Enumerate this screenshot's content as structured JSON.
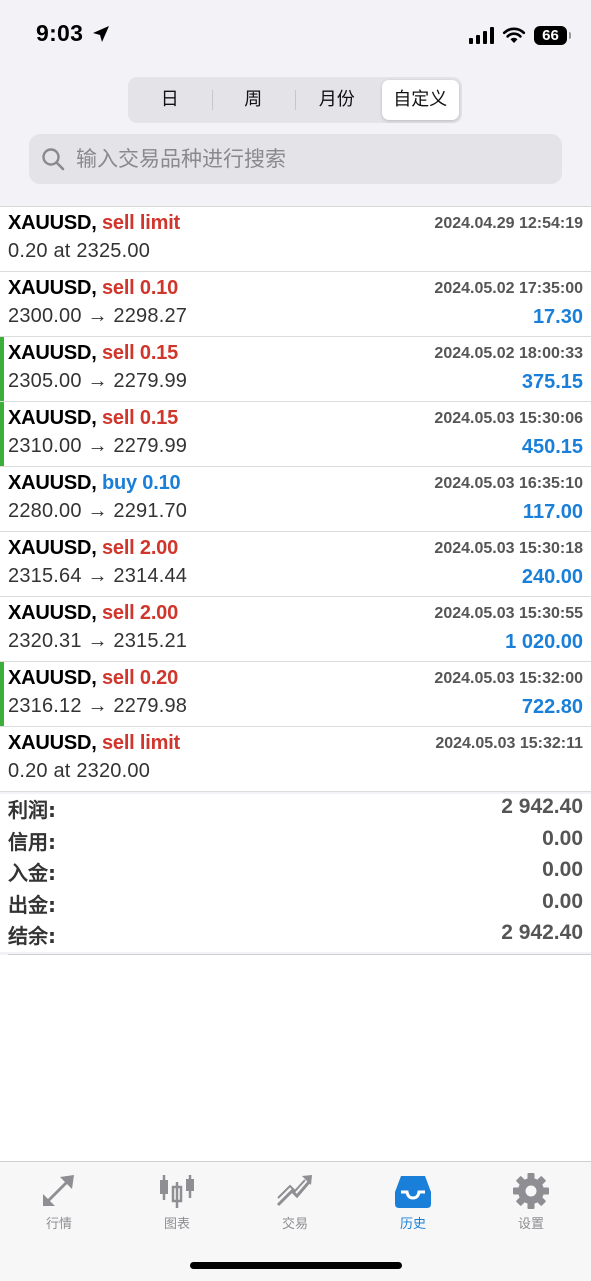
{
  "status_bar": {
    "time": "9:03",
    "battery": "66"
  },
  "period_tabs": [
    {
      "label": "日",
      "active": false
    },
    {
      "label": "周",
      "active": false
    },
    {
      "label": "月份",
      "active": false
    },
    {
      "label": "自定义",
      "active": true
    }
  ],
  "search": {
    "placeholder": "输入交易品种进行搜索"
  },
  "deals": [
    {
      "symbol": "XAUUSD",
      "side": "sell",
      "action": "sell limit",
      "time": "2024.04.29 12:54:19",
      "prices": "0.20 at 2325.00",
      "profit": "",
      "marked": false
    },
    {
      "symbol": "XAUUSD",
      "side": "sell",
      "action": "sell 0.10",
      "time": "2024.05.02 17:35:00",
      "prices": "2300.00 → 2298.27",
      "profit": "17.30",
      "marked": false
    },
    {
      "symbol": "XAUUSD",
      "side": "sell",
      "action": "sell 0.15",
      "time": "2024.05.02 18:00:33",
      "prices": "2305.00 → 2279.99",
      "profit": "375.15",
      "marked": true
    },
    {
      "symbol": "XAUUSD",
      "side": "sell",
      "action": "sell 0.15",
      "time": "2024.05.03 15:30:06",
      "prices": "2310.00 → 2279.99",
      "profit": "450.15",
      "marked": true
    },
    {
      "symbol": "XAUUSD",
      "side": "buy",
      "action": "buy 0.10",
      "time": "2024.05.03 16:35:10",
      "prices": "2280.00 → 2291.70",
      "profit": "117.00",
      "marked": false
    },
    {
      "symbol": "XAUUSD",
      "side": "sell",
      "action": "sell 2.00",
      "time": "2024.05.03 15:30:18",
      "prices": "2315.64 → 2314.44",
      "profit": "240.00",
      "marked": false
    },
    {
      "symbol": "XAUUSD",
      "side": "sell",
      "action": "sell 2.00",
      "time": "2024.05.03 15:30:55",
      "prices": "2320.31 → 2315.21",
      "profit": "1 020.00",
      "marked": false
    },
    {
      "symbol": "XAUUSD",
      "side": "sell",
      "action": "sell 0.20",
      "time": "2024.05.03 15:32:00",
      "prices": "2316.12 → 2279.98",
      "profit": "722.80",
      "marked": true
    },
    {
      "symbol": "XAUUSD",
      "side": "sell",
      "action": "sell limit",
      "time": "2024.05.03 15:32:11",
      "prices": "0.20 at 2320.00",
      "profit": "",
      "marked": false
    }
  ],
  "summary": [
    {
      "label": "利润:",
      "value": "2 942.40"
    },
    {
      "label": "信用:",
      "value": "0.00"
    },
    {
      "label": "入金:",
      "value": "0.00"
    },
    {
      "label": "出金:",
      "value": "0.00"
    },
    {
      "label": "结余:",
      "value": "2 942.40"
    }
  ],
  "tab_bar": [
    {
      "label": "行情",
      "icon": "quotes-icon",
      "active": false
    },
    {
      "label": "图表",
      "icon": "chart-icon",
      "active": false
    },
    {
      "label": "交易",
      "icon": "trade-icon",
      "active": false
    },
    {
      "label": "历史",
      "icon": "history-icon",
      "active": true
    },
    {
      "label": "设置",
      "icon": "settings-icon",
      "active": false
    }
  ],
  "colors": {
    "sell": "#d0362b",
    "buy": "#1a7fd8",
    "profit": "#1a7fd8",
    "marker": "#3cae3a",
    "active_tab": "#1a7fd8",
    "inactive_tab": "#8e8e93"
  }
}
